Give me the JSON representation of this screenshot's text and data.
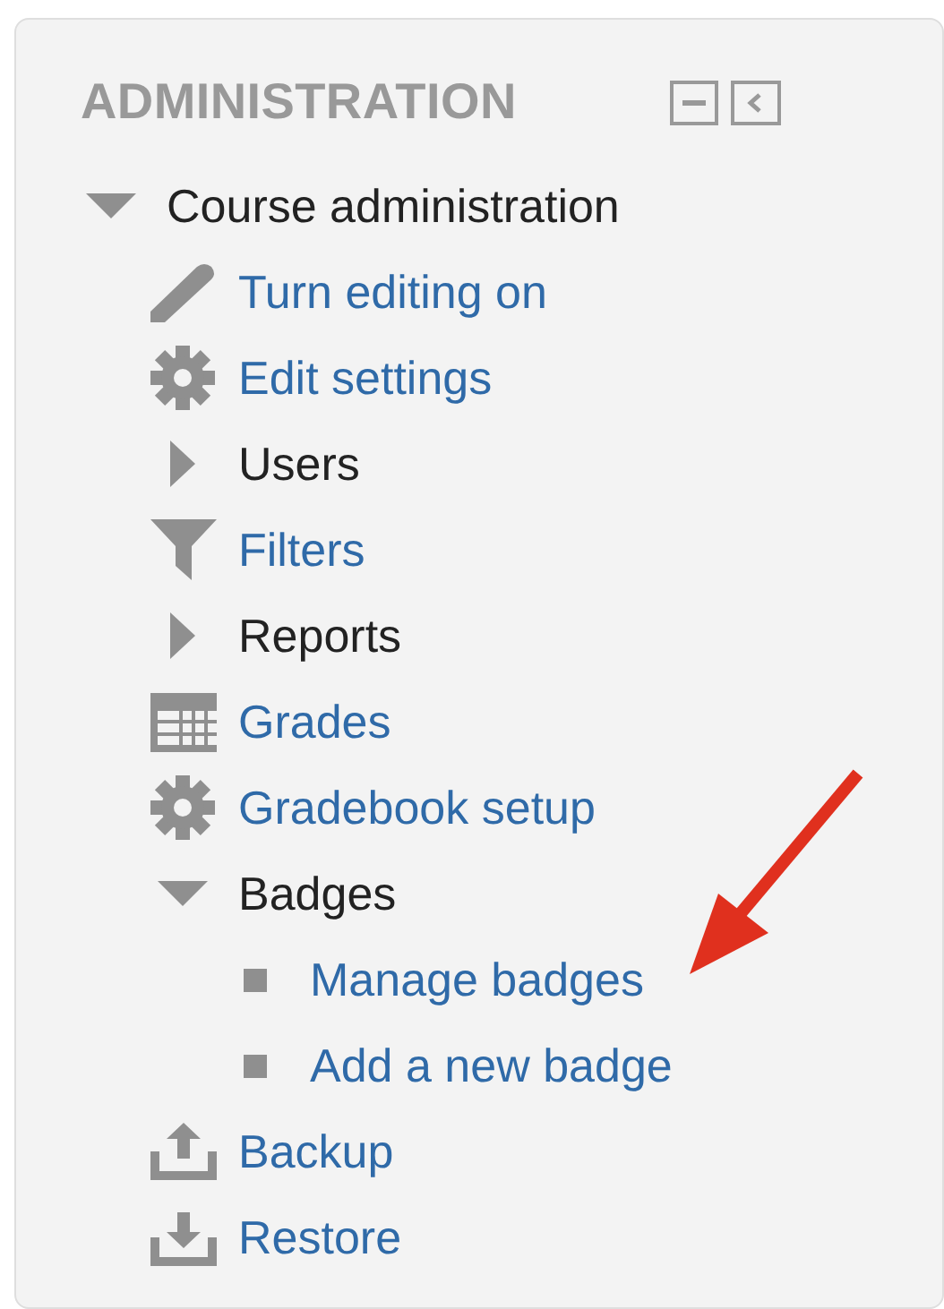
{
  "block": {
    "title": "ADMINISTRATION",
    "tree": [
      {
        "label": "Course administration",
        "kind": "branch",
        "expanded": true,
        "children": [
          {
            "label": "Turn editing on",
            "kind": "pencil"
          },
          {
            "label": "Edit settings",
            "kind": "gear"
          },
          {
            "label": "Users",
            "kind": "branch",
            "expanded": false
          },
          {
            "label": "Filters",
            "kind": "filter"
          },
          {
            "label": "Reports",
            "kind": "branch",
            "expanded": false
          },
          {
            "label": "Grades",
            "kind": "grid"
          },
          {
            "label": "Gradebook setup",
            "kind": "gear"
          },
          {
            "label": "Badges",
            "kind": "branch",
            "expanded": true,
            "children": [
              {
                "label": "Manage badges",
                "kind": "leaf"
              },
              {
                "label": "Add a new badge",
                "kind": "leaf"
              }
            ]
          },
          {
            "label": "Backup",
            "kind": "upload"
          },
          {
            "label": "Restore",
            "kind": "download"
          }
        ]
      }
    ]
  }
}
